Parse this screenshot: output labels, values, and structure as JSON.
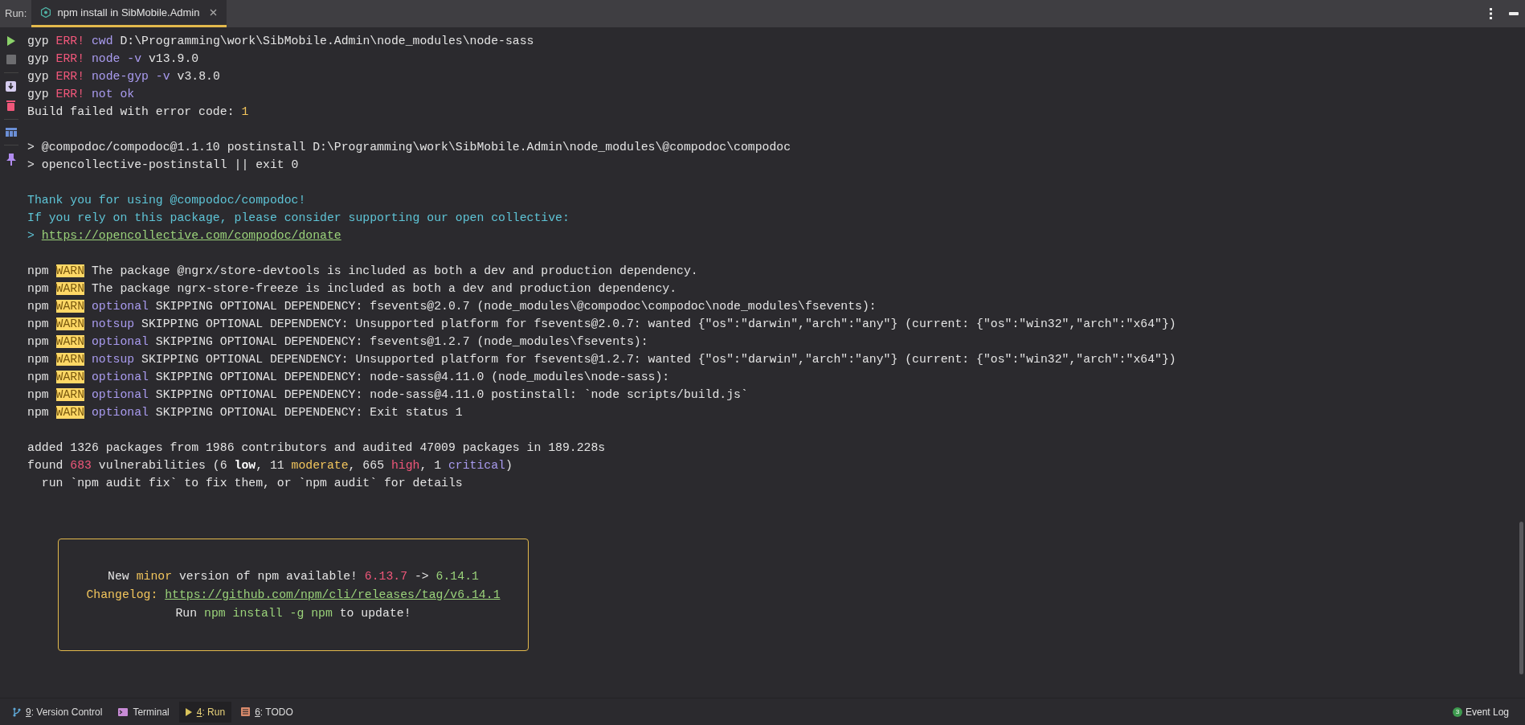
{
  "toolbar_label": "Run:",
  "tab": {
    "title": "npm install in SibMobile.Admin",
    "selected": true
  },
  "console": {
    "lines": [
      {
        "kind": "text",
        "segments": [
          {
            "text": "gyp ",
            "kind": "plain"
          },
          {
            "text": "ERR!",
            "kind": "error"
          },
          {
            "text": " cwd",
            "kind": "keyword"
          },
          {
            "text": " D:\\Programming\\work\\SibMobile.Admin\\node_modules\\node-sass",
            "kind": "plain"
          }
        ]
      },
      {
        "kind": "text",
        "segments": [
          {
            "text": "gyp ",
            "kind": "plain"
          },
          {
            "text": "ERR!",
            "kind": "error"
          },
          {
            "text": " node -v",
            "kind": "keyword"
          },
          {
            "text": " v13.9.0",
            "kind": "plain"
          }
        ]
      },
      {
        "kind": "text",
        "segments": [
          {
            "text": "gyp ",
            "kind": "plain"
          },
          {
            "text": "ERR!",
            "kind": "error"
          },
          {
            "text": " node-gyp -v",
            "kind": "keyword"
          },
          {
            "text": " v3.8.0",
            "kind": "plain"
          }
        ]
      },
      {
        "kind": "text",
        "segments": [
          {
            "text": "gyp ",
            "kind": "plain"
          },
          {
            "text": "ERR!",
            "kind": "error"
          },
          {
            "text": " not ok",
            "kind": "keyword"
          }
        ]
      },
      {
        "kind": "text",
        "segments": [
          {
            "text": "Build failed with error code: ",
            "kind": "plain"
          },
          {
            "text": "1",
            "kind": "number"
          }
        ]
      },
      {
        "kind": "blank"
      },
      {
        "kind": "text",
        "segments": [
          {
            "text": "> @compodoc/compodoc@1.1.10 postinstall D:\\Programming\\work\\SibMobile.Admin\\node_modules\\@compodoc\\compodoc",
            "kind": "plain"
          }
        ]
      },
      {
        "kind": "text",
        "segments": [
          {
            "text": "> opencollective-postinstall || exit 0",
            "kind": "plain"
          }
        ]
      },
      {
        "kind": "blank"
      },
      {
        "kind": "text",
        "segments": [
          {
            "text": "Thank you for using @compodoc/compodoc!",
            "kind": "info"
          }
        ]
      },
      {
        "kind": "text",
        "segments": [
          {
            "text": "If you rely on this package, please consider supporting our open collective:",
            "kind": "info"
          }
        ]
      },
      {
        "kind": "text",
        "segments": [
          {
            "text": "> ",
            "kind": "info"
          },
          {
            "text": "https://opencollective.com/compodoc/donate",
            "kind": "link"
          }
        ]
      },
      {
        "kind": "blank"
      },
      {
        "kind": "text",
        "segments": [
          {
            "text": "npm ",
            "kind": "plain"
          },
          {
            "text": "WARN",
            "kind": "warning"
          },
          {
            "text": " The package @ngrx/store-devtools is included as both a dev and production dependency.",
            "kind": "plain"
          }
        ]
      },
      {
        "kind": "text",
        "segments": [
          {
            "text": "npm ",
            "kind": "plain"
          },
          {
            "text": "WARN",
            "kind": "warning"
          },
          {
            "text": " The package ngrx-store-freeze is included as both a dev and production dependency.",
            "kind": "plain"
          }
        ]
      },
      {
        "kind": "text",
        "segments": [
          {
            "text": "npm ",
            "kind": "plain"
          },
          {
            "text": "WARN",
            "kind": "warning"
          },
          {
            "text": " optional",
            "kind": "keyword"
          },
          {
            "text": " SKIPPING OPTIONAL DEPENDENCY: fsevents@2.0.7 (node_modules\\@compodoc\\compodoc\\node_modules\\fsevents):",
            "kind": "plain"
          }
        ]
      },
      {
        "kind": "text",
        "segments": [
          {
            "text": "npm ",
            "kind": "plain"
          },
          {
            "text": "WARN",
            "kind": "warning"
          },
          {
            "text": " notsup",
            "kind": "keyword"
          },
          {
            "text": " SKIPPING OPTIONAL DEPENDENCY: Unsupported platform for fsevents@2.0.7: wanted {\"os\":\"darwin\",\"arch\":\"any\"} (current: {\"os\":\"win32\",\"arch\":\"x64\"})",
            "kind": "plain"
          }
        ]
      },
      {
        "kind": "text",
        "segments": [
          {
            "text": "npm ",
            "kind": "plain"
          },
          {
            "text": "WARN",
            "kind": "warning"
          },
          {
            "text": " optional",
            "kind": "keyword"
          },
          {
            "text": " SKIPPING OPTIONAL DEPENDENCY: fsevents@1.2.7 (node_modules\\fsevents):",
            "kind": "plain"
          }
        ]
      },
      {
        "kind": "text",
        "segments": [
          {
            "text": "npm ",
            "kind": "plain"
          },
          {
            "text": "WARN",
            "kind": "warning"
          },
          {
            "text": " notsup",
            "kind": "keyword"
          },
          {
            "text": " SKIPPING OPTIONAL DEPENDENCY: Unsupported platform for fsevents@1.2.7: wanted {\"os\":\"darwin\",\"arch\":\"any\"} (current: {\"os\":\"win32\",\"arch\":\"x64\"})",
            "kind": "plain"
          }
        ]
      },
      {
        "kind": "text",
        "segments": [
          {
            "text": "npm ",
            "kind": "plain"
          },
          {
            "text": "WARN",
            "kind": "warning"
          },
          {
            "text": " optional",
            "kind": "keyword"
          },
          {
            "text": " SKIPPING OPTIONAL DEPENDENCY: node-sass@4.11.0 (node_modules\\node-sass):",
            "kind": "plain"
          }
        ]
      },
      {
        "kind": "text",
        "segments": [
          {
            "text": "npm ",
            "kind": "plain"
          },
          {
            "text": "WARN",
            "kind": "warning"
          },
          {
            "text": " optional",
            "kind": "keyword"
          },
          {
            "text": " SKIPPING OPTIONAL DEPENDENCY: node-sass@4.11.0 postinstall: `node scripts/build.js`",
            "kind": "plain"
          }
        ]
      },
      {
        "kind": "text",
        "segments": [
          {
            "text": "npm ",
            "kind": "plain"
          },
          {
            "text": "WARN",
            "kind": "warning"
          },
          {
            "text": " optional",
            "kind": "keyword"
          },
          {
            "text": " SKIPPING OPTIONAL DEPENDENCY: Exit status 1",
            "kind": "plain"
          }
        ]
      },
      {
        "kind": "blank"
      },
      {
        "kind": "text",
        "segments": [
          {
            "text": "added 1326 packages from 1986 contributors and audited 47009 packages in 189.228s",
            "kind": "plain"
          }
        ]
      },
      {
        "kind": "text",
        "segments": [
          {
            "text": "found ",
            "kind": "plain"
          },
          {
            "text": "683",
            "kind": "error"
          },
          {
            "text": " vulnerabilities (6 ",
            "kind": "plain"
          },
          {
            "text": "low",
            "kind": "strong"
          },
          {
            "text": ", 11 ",
            "kind": "plain"
          },
          {
            "text": "moderate",
            "kind": "number"
          },
          {
            "text": ", 665 ",
            "kind": "plain"
          },
          {
            "text": "high",
            "kind": "error"
          },
          {
            "text": ", 1 ",
            "kind": "plain"
          },
          {
            "text": "critical",
            "kind": "keyword"
          },
          {
            "text": ")",
            "kind": "plain"
          }
        ]
      },
      {
        "kind": "text",
        "segments": [
          {
            "text": "  run `npm audit fix` to fix them, or `npm audit` for details",
            "kind": "plain"
          }
        ]
      }
    ],
    "notice": {
      "lines": [
        {
          "segments": [
            {
              "text": "New ",
              "kind": "plain"
            },
            {
              "text": "minor",
              "kind": "number"
            },
            {
              "text": " version of npm available! ",
              "kind": "plain"
            },
            {
              "text": "6.13.7",
              "kind": "error"
            },
            {
              "text": " -> ",
              "kind": "plain"
            },
            {
              "text": "6.14.1",
              "kind": "success"
            }
          ]
        },
        {
          "segments": [
            {
              "text": "Changelog: ",
              "kind": "number"
            },
            {
              "text": "https://github.com/npm/cli/releases/tag/v6.14.1",
              "kind": "link"
            }
          ]
        },
        {
          "segments": [
            {
              "text": "Run ",
              "kind": "plain"
            },
            {
              "text": "npm install -g npm",
              "kind": "success"
            },
            {
              "text": " to update!",
              "kind": "plain"
            }
          ]
        }
      ]
    }
  },
  "bottom_bar": {
    "tools": [
      {
        "kind": "vcs",
        "mnemonic": "9",
        "label": ": Version Control",
        "selected": false
      },
      {
        "kind": "terminal",
        "label": "Terminal",
        "selected": false
      },
      {
        "kind": "run",
        "mnemonic": "4",
        "label": ": Run",
        "selected": true
      },
      {
        "kind": "todo",
        "mnemonic": "6",
        "label": ": TODO",
        "selected": false
      }
    ],
    "event_log": {
      "count": "3",
      "label": "Event Log"
    }
  }
}
